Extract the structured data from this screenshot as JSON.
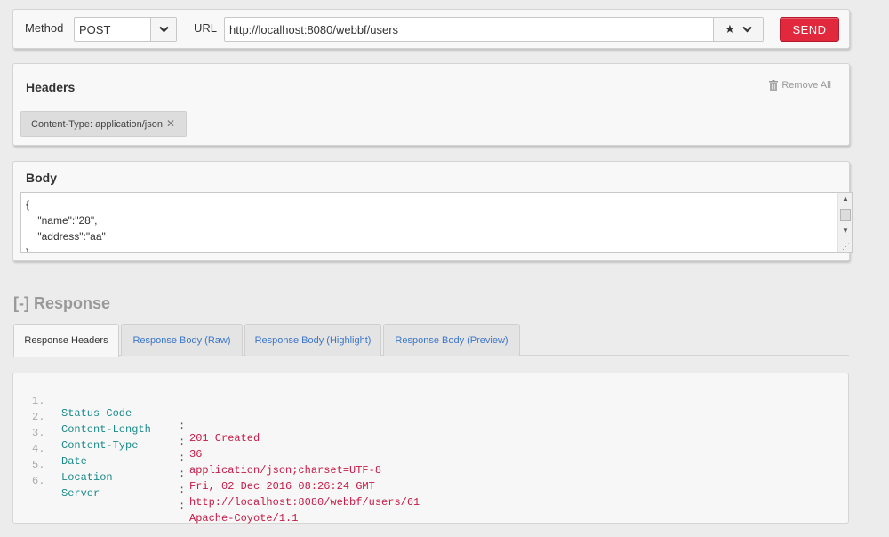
{
  "request": {
    "method_label": "Method",
    "method_value": "POST",
    "url_label": "URL",
    "url_value": "http://localhost:8080/webbf/users",
    "send_label": "SEND"
  },
  "headers": {
    "title": "Headers",
    "remove_all_label": "Remove All",
    "items": [
      {
        "text": "Content-Type: application/json"
      }
    ]
  },
  "body": {
    "title": "Body",
    "lines": [
      "{",
      "    \"name\":\"28\",",
      "    \"address\":\"aa\"",
      "}"
    ]
  },
  "response": {
    "toggle": "[-]",
    "title": "Response",
    "tabs": [
      {
        "label": "Response Headers",
        "active": true
      },
      {
        "label": "Response Body (Raw)",
        "active": false
      },
      {
        "label": "Response Body (Highlight)",
        "active": false
      },
      {
        "label": "Response Body (Preview)",
        "active": false
      }
    ],
    "header_rows": [
      {
        "num": "1.",
        "key": "Status Code",
        "value": "201 Created"
      },
      {
        "num": "2.",
        "key": "Content-Length",
        "value": "36"
      },
      {
        "num": "3.",
        "key": "Content-Type",
        "value": "application/json;charset=UTF-8"
      },
      {
        "num": "4.",
        "key": "Date",
        "value": "Fri, 02 Dec 2016 08:26:24 GMT"
      },
      {
        "num": "5.",
        "key": "Location",
        "value": "http://localhost:8080/webbf/users/61"
      },
      {
        "num": "6.",
        "key": "Server",
        "value": "Apache-Coyote/1.1"
      }
    ]
  },
  "colors": {
    "send": "#e2283c",
    "link": "#3b76c9",
    "key": "#1b8a8a",
    "value": "#c41a45",
    "background": "#ececec"
  },
  "icons": {
    "method_dropdown": "chevron-down-icon",
    "favorite": "star-icon",
    "url_dropdown": "chevron-down-icon",
    "remove_all": "trash-icon",
    "remove_header": "close-icon"
  }
}
